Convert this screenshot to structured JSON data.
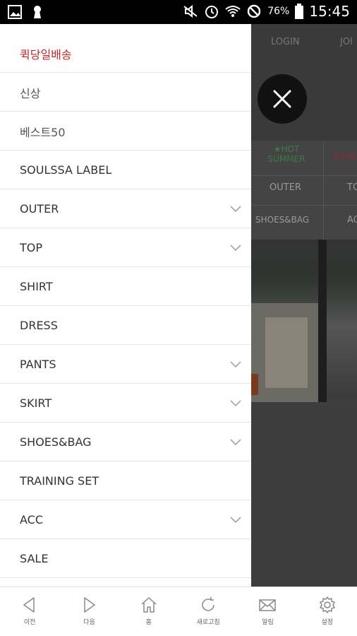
{
  "status_bar": {
    "battery_percent": "76%",
    "time": "15:45",
    "icons": [
      "gallery-icon",
      "keyhole-icon",
      "mute-icon",
      "alarm-icon",
      "wifi-icon",
      "block-icon",
      "battery-icon"
    ]
  },
  "background_page": {
    "nav": {
      "login": "LOGIN",
      "join": "JOI"
    },
    "menu": {
      "hot_summer": "★HOT SUMMER",
      "quick": "퀵당일",
      "outer": "OUTER",
      "top": "TO",
      "shoes_bag": "SHOES&BAG",
      "acc": "AC"
    }
  },
  "drawer": {
    "items": [
      {
        "label": "퀵당일배송",
        "accent": true,
        "expandable": false
      },
      {
        "label": "신상",
        "accent": false,
        "expandable": false
      },
      {
        "label": "베스트50",
        "accent": false,
        "expandable": false
      },
      {
        "label": "SOULSSA LABEL",
        "accent": false,
        "expandable": false
      },
      {
        "label": "OUTER",
        "accent": false,
        "expandable": true
      },
      {
        "label": "TOP",
        "accent": false,
        "expandable": true
      },
      {
        "label": "SHIRT",
        "accent": false,
        "expandable": false
      },
      {
        "label": "DRESS",
        "accent": false,
        "expandable": false
      },
      {
        "label": "PANTS",
        "accent": false,
        "expandable": true
      },
      {
        "label": "SKIRT",
        "accent": false,
        "expandable": true
      },
      {
        "label": "SHOES&BAG",
        "accent": false,
        "expandable": true
      },
      {
        "label": "TRAINING SET",
        "accent": false,
        "expandable": false
      },
      {
        "label": "ACC",
        "accent": false,
        "expandable": true
      },
      {
        "label": "SALE",
        "accent": false,
        "expandable": false
      }
    ]
  },
  "toolbar": {
    "items": [
      {
        "label": "이전",
        "icon": "back-arrow-icon"
      },
      {
        "label": "다음",
        "icon": "forward-arrow-icon"
      },
      {
        "label": "홈",
        "icon": "home-icon"
      },
      {
        "label": "새로고침",
        "icon": "refresh-icon"
      },
      {
        "label": "알림",
        "icon": "mail-icon"
      },
      {
        "label": "설정",
        "icon": "gear-icon"
      }
    ]
  },
  "colors": {
    "accent": "#c3272b",
    "hot_summer": "#2e6b3a"
  }
}
